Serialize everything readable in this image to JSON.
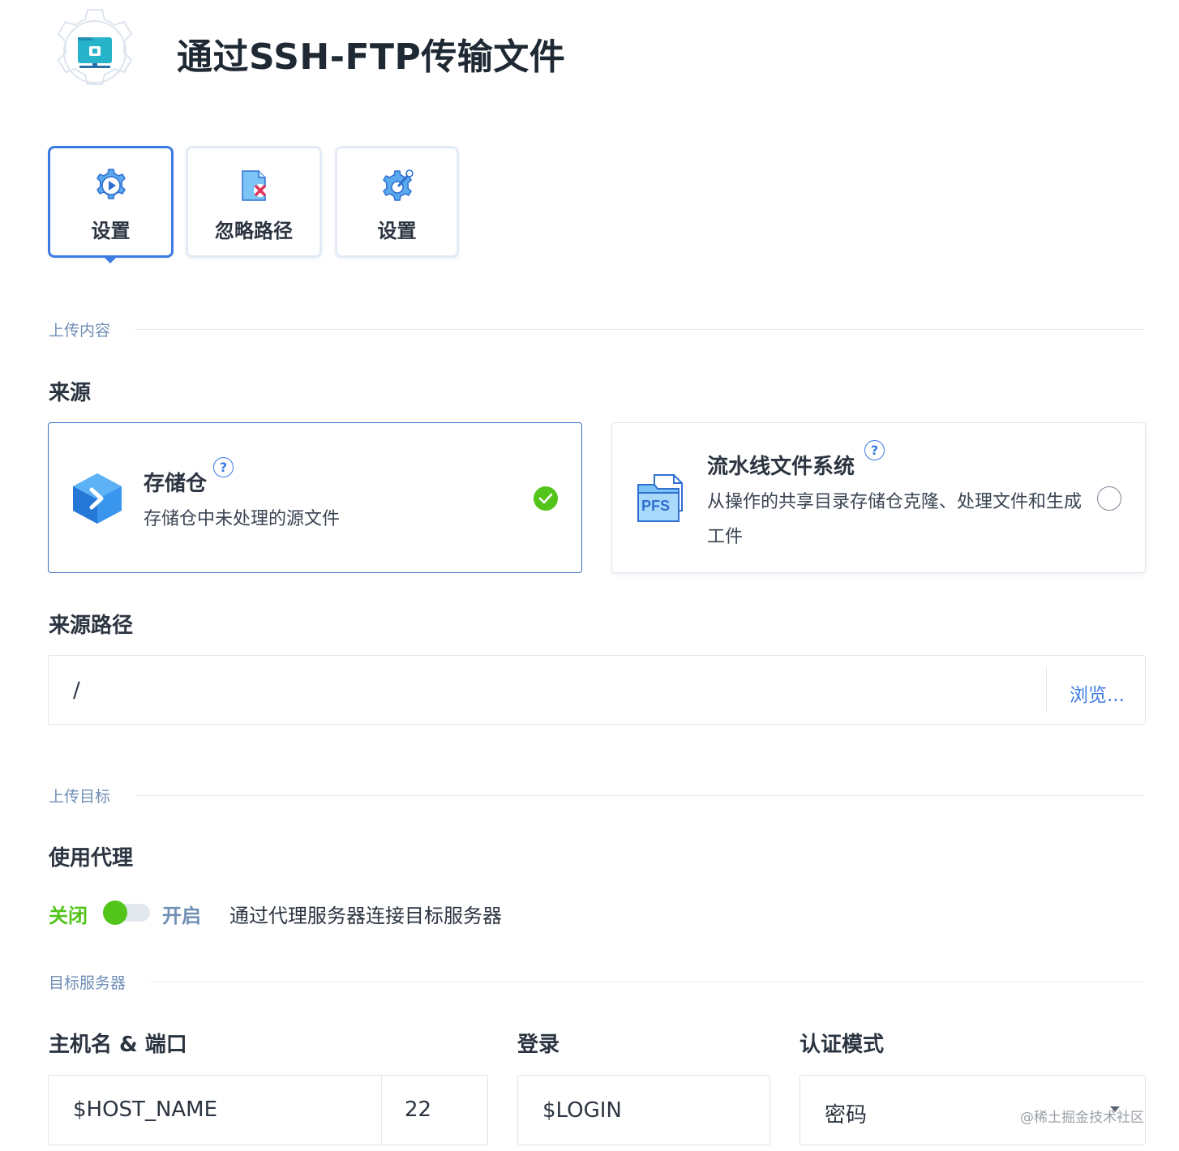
{
  "header": {
    "title": "通过SSH-FTP传输文件",
    "icon": "folder-lock-gear-icon"
  },
  "tabs": [
    {
      "label": "设置",
      "icon": "play-gear-icon",
      "active": true
    },
    {
      "label": "忽略路径",
      "icon": "file-remove-icon",
      "active": false
    },
    {
      "label": "设置",
      "icon": "wrench-gear-icon",
      "active": false
    }
  ],
  "upload_content": {
    "section_label": "上传内容",
    "source_label": "来源",
    "sources": [
      {
        "title": "存储仓",
        "description": "存储仓中未处理的源文件",
        "icon": "repository-icon",
        "selected": true
      },
      {
        "title": "流水线文件系统",
        "description": "从操作的共享目录存储仓克隆、处理文件和生成工件",
        "icon": "pfs-file-icon",
        "selected": false,
        "icon_text": "PFS"
      }
    ],
    "source_path_label": "来源路径",
    "source_path_value": "/",
    "browse_label": "浏览..."
  },
  "upload_target": {
    "section_label": "上传目标",
    "proxy_label": "使用代理",
    "toggle_off": "关闭",
    "toggle_on": "开启",
    "toggle_state": "off",
    "proxy_description": "通过代理服务器连接目标服务器"
  },
  "target_server": {
    "section_label": "目标服务器",
    "host_label": "主机名 & 端口",
    "host_value": "$HOST_NAME",
    "port_value": "22",
    "login_label": "登录",
    "login_value": "$LOGIN",
    "auth_label": "认证模式",
    "auth_value": "密码"
  },
  "watermark": "@稀土掘金技术社区",
  "colors": {
    "accent": "#3b7be2",
    "success": "#52c41a",
    "section_text": "#6f8fb5"
  }
}
